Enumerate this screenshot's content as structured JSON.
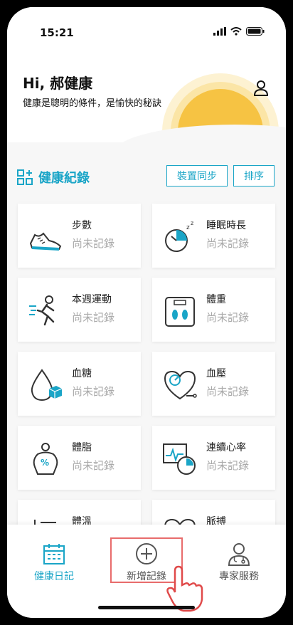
{
  "status": {
    "time": "15:21"
  },
  "header": {
    "greeting": "Hi, 郝健康",
    "subtitle": "健康是聰明的條件，是愉快的秘訣"
  },
  "section": {
    "title": "健康紀錄",
    "sync_label": "裝置同步",
    "sort_label": "排序"
  },
  "cards": [
    {
      "title": "步數",
      "value": "尚未記錄",
      "icon": "shoe-icon"
    },
    {
      "title": "睡眠時長",
      "value": "尚未記錄",
      "icon": "sleep-clock-icon"
    },
    {
      "title": "本週運動",
      "value": "尚未記錄",
      "icon": "running-icon"
    },
    {
      "title": "體重",
      "value": "尚未記錄",
      "icon": "scale-icon"
    },
    {
      "title": "血糖",
      "value": "尚未記錄",
      "icon": "blood-drop-icon"
    },
    {
      "title": "血壓",
      "value": "尚未記錄",
      "icon": "heart-gauge-icon"
    },
    {
      "title": "體脂",
      "value": "尚未記錄",
      "icon": "body-fat-icon"
    },
    {
      "title": "連續心率",
      "value": "尚未記錄",
      "icon": "heart-rate-clock-icon"
    },
    {
      "title": "體溫",
      "value": "",
      "icon": "thermometer-icon"
    },
    {
      "title": "脈搏",
      "value": "",
      "icon": "heart-icon"
    }
  ],
  "tabs": {
    "diary": "健康日記",
    "add": "新增記錄",
    "expert": "專家服務"
  },
  "colors": {
    "accent": "#1aa5c7",
    "highlight": "#e86c6c",
    "sun": "#f6c343"
  }
}
